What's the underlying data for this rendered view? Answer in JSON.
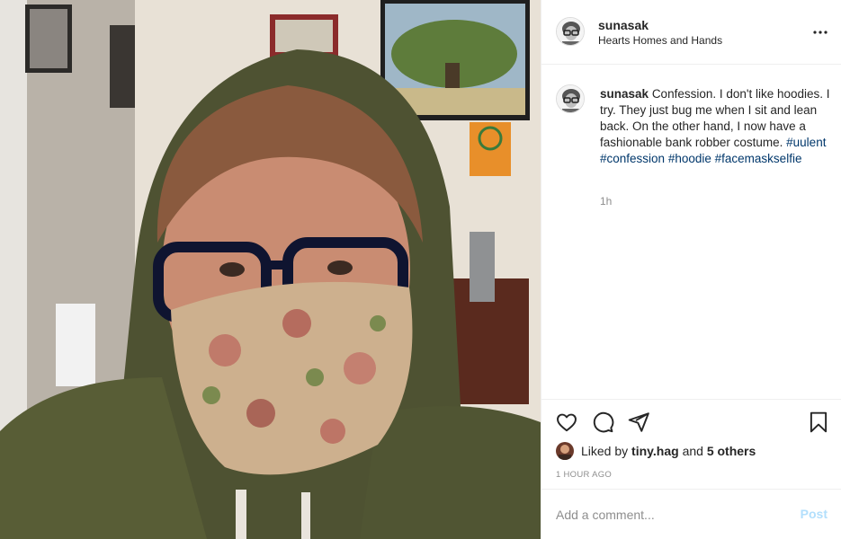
{
  "post": {
    "image_alt": "Selfie of a person in a green hoodie wearing glasses and a floral face mask"
  },
  "header": {
    "username": "sunasak",
    "location": "Hearts Homes and Hands",
    "more_icon": "more-options-icon"
  },
  "caption": {
    "username": "sunasak",
    "text": "Confession. I don't like hoodies. I try. They just bug me when I sit and lean back. On the other hand, I now have a fashionable bank robber costume.",
    "hashtags": [
      "#uulent",
      "#confession",
      "#hoodie",
      "#facemaskselfie"
    ],
    "time": "1h"
  },
  "actions": {
    "icons": [
      "heart-icon",
      "comment-icon",
      "share-icon",
      "bookmark-icon"
    ]
  },
  "likes": {
    "prefix": "Liked by",
    "user": "tiny.hag",
    "and": "and",
    "others": "5 others"
  },
  "timestamp": "1 HOUR AGO",
  "comment": {
    "placeholder": "Add a comment...",
    "post_label": "Post"
  },
  "colors": {
    "hashtag": "#00376b",
    "post_disabled": "#b2dffc",
    "muted": "#8e8e8e"
  }
}
